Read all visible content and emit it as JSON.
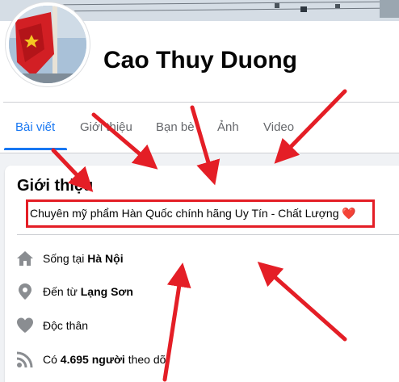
{
  "profile": {
    "name": "Cao Thuy Duong"
  },
  "tabs": [
    {
      "label": "Bài viết",
      "active": true
    },
    {
      "label": "Giới thiệu",
      "active": false
    },
    {
      "label": "Bạn bè",
      "active": false
    },
    {
      "label": "Ảnh",
      "active": false
    },
    {
      "label": "Video",
      "active": false
    }
  ],
  "intro": {
    "title": "Giới thiệu",
    "bio": "Chuyên mỹ phẩm Hàn Quốc chính hãng Uy Tín - Chất Lượng",
    "bio_emoji": "❤️",
    "lives_in_prefix": "Sống tại ",
    "lives_in_place": "Hà Nội",
    "from_prefix": "Đến từ ",
    "from_place": "Lạng Sơn",
    "relationship": "Độc thân",
    "followers_prefix": "Có ",
    "followers_count": "4.695 người",
    "followers_suffix": " theo dõi"
  },
  "colors": {
    "accent": "#1877f2",
    "annotation_red": "#e41e26",
    "icon_gray": "#8a8d91"
  }
}
